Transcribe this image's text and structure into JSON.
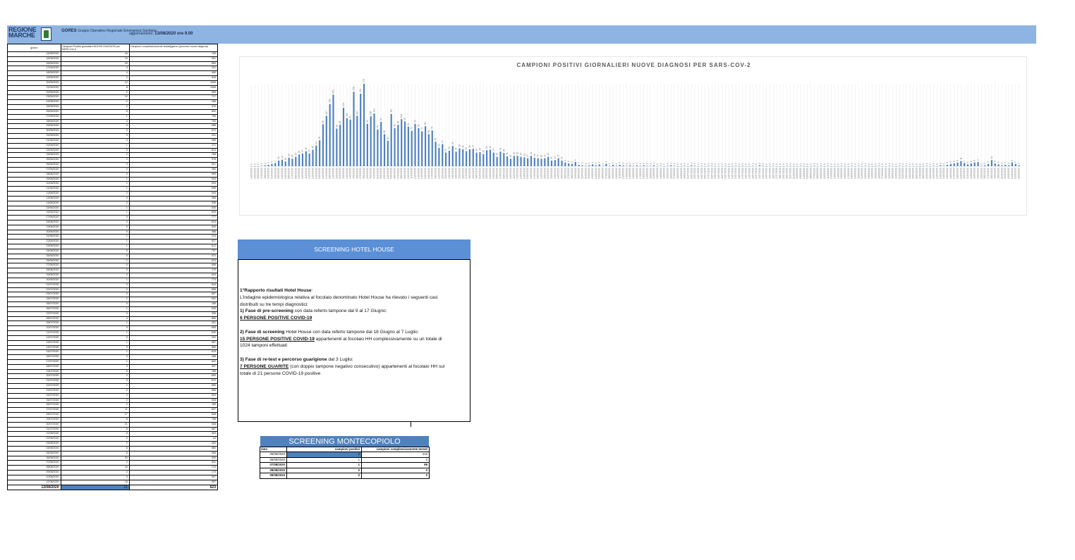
{
  "header": {
    "logo_text": "REGIONE MARCHE",
    "org_name": "GORES",
    "org_desc": "Gruppo Operativo Regionale Emergenza Sanitaria",
    "update_label": "aggiornamento:",
    "update_value": "13/08/2020 ore 9.00",
    "banner_color": "#8eb4e3"
  },
  "left_table": {
    "headers": [
      "giorno",
      "Campioni Positivi giornalieri NUOVE DIAGNOSI per SARS-Cov-2",
      "Campioni complessivamente testati(giorno (percorso nuove diagnosi)"
    ],
    "rows": [
      [
        "14/05/2020",
        "16",
        "783"
      ],
      [
        "15/05/2020",
        "24",
        "991"
      ],
      [
        "16/05/2020",
        "25",
        "863"
      ],
      [
        "17/05/2020",
        "4",
        "321"
      ],
      [
        "18/05/2020",
        "4",
        "460"
      ],
      [
        "19/05/2020",
        "2",
        "916"
      ],
      [
        "20/05/2020",
        "12",
        "1063"
      ],
      [
        "21/05/2020",
        "8",
        "1006"
      ],
      [
        "22/05/2020",
        "2",
        "559"
      ],
      [
        "23/05/2020",
        "12",
        "717"
      ],
      [
        "24/05/2020",
        "2",
        "398"
      ],
      [
        "25/05/2020",
        "2",
        "576"
      ],
      [
        "26/05/2020",
        "6",
        "892"
      ],
      [
        "27/05/2020",
        "1",
        "796"
      ],
      [
        "28/05/2020",
        "4",
        "750"
      ],
      [
        "29/05/2020",
        "4",
        "986"
      ],
      [
        "30/05/2020",
        "3",
        "670"
      ],
      [
        "31/05/2020",
        "0",
        "251"
      ],
      [
        "01/06/2020",
        "4",
        "386"
      ],
      [
        "02/06/2020",
        "1",
        "371"
      ],
      [
        "03/06/2020",
        "3",
        "624"
      ],
      [
        "04/06/2020",
        "2",
        "768"
      ],
      [
        "05/06/2020",
        "2",
        "978"
      ],
      [
        "06/06/2020",
        "3",
        "601"
      ],
      [
        "07/06/2020",
        "0",
        "360"
      ],
      [
        "08/06/2020",
        "0",
        "599"
      ],
      [
        "09/06/2020",
        "1",
        "903"
      ],
      [
        "10/06/2020",
        "1",
        "694"
      ],
      [
        "11/06/2020",
        "1",
        "698"
      ],
      [
        "12/06/2020",
        "2",
        "544"
      ],
      [
        "13/06/2020",
        "4",
        "385"
      ],
      [
        "14/06/2020",
        "2",
        "398"
      ],
      [
        "15/06/2020",
        "1",
        "630"
      ],
      [
        "16/06/2020",
        "1",
        "633"
      ],
      [
        "17/06/2020",
        "4",
        "777"
      ],
      [
        "18/06/2020",
        "0",
        "624"
      ],
      [
        "19/06/2020",
        "0",
        "549"
      ],
      [
        "20/06/2020",
        "0",
        "488"
      ],
      [
        "21/06/2020",
        "1",
        "224"
      ],
      [
        "22/06/2020",
        "1",
        "527"
      ],
      [
        "23/06/2020",
        "1",
        "612"
      ],
      [
        "24/06/2020",
        "0",
        "797"
      ],
      [
        "25/06/2020",
        "0",
        "572"
      ],
      [
        "26/06/2020",
        "2",
        "623"
      ],
      [
        "27/06/2020",
        "0",
        "656"
      ],
      [
        "28/06/2020",
        "0",
        "179"
      ],
      [
        "29/06/2020",
        "0",
        "624"
      ],
      [
        "30/06/2020",
        "1",
        "774"
      ],
      [
        "01/07/2020",
        "3",
        "844"
      ],
      [
        "02/07/2020",
        "0",
        "686"
      ],
      [
        "03/07/2020",
        "0",
        "857"
      ],
      [
        "04/07/2020",
        "1",
        "602"
      ],
      [
        "05/07/2020",
        "0",
        "185"
      ],
      [
        "06/07/2020",
        "1",
        "549"
      ],
      [
        "07/07/2020",
        "3",
        "396"
      ],
      [
        "08/07/2020",
        "4",
        "660"
      ],
      [
        "09/07/2020",
        "1",
        "451"
      ],
      [
        "10/07/2020",
        "0",
        "605"
      ],
      [
        "11/07/2020",
        "1",
        "630"
      ],
      [
        "12/07/2020",
        "0",
        "202"
      ],
      [
        "13/07/2020",
        "1",
        "557"
      ],
      [
        "14/07/2020",
        "0",
        "650"
      ],
      [
        "15/07/2020",
        "1",
        "619"
      ],
      [
        "16/07/2020",
        "3",
        "458"
      ],
      [
        "17/07/2020",
        "1",
        "542"
      ],
      [
        "18/07/2020",
        "0",
        "497"
      ],
      [
        "19/07/2020",
        "0",
        "185"
      ],
      [
        "20/07/2020",
        "2",
        "650"
      ],
      [
        "21/07/2020",
        "3",
        "672"
      ],
      [
        "22/07/2020",
        "1",
        "660"
      ],
      [
        "23/07/2020",
        "2",
        "558"
      ],
      [
        "24/07/2020",
        "2",
        "503"
      ],
      [
        "25/07/2020",
        "2",
        "528"
      ],
      [
        "26/07/2020",
        "2",
        "189"
      ],
      [
        "27/07/2020",
        "11",
        "607"
      ],
      [
        "28/07/2020",
        "17",
        "698"
      ],
      [
        "29/07/2020",
        "8",
        "756"
      ],
      [
        "30/07/2020",
        "21",
        "506"
      ],
      [
        "31/07/2020",
        "5",
        "567"
      ],
      [
        "01/08/2020",
        "8",
        "563"
      ],
      [
        "02/08/2020",
        "0",
        "54"
      ],
      [
        "03/08/2020",
        "2",
        "483"
      ],
      [
        "04/08/2020",
        "6",
        "860"
      ],
      [
        "05/08/2020",
        "6",
        "558"
      ],
      [
        "06/08/2020",
        "20",
        "593"
      ],
      [
        "07/08/2020",
        "2",
        "531"
      ],
      [
        "08/08/2020",
        "16",
        "713"
      ],
      [
        "09/08/2020",
        "2",
        "173"
      ],
      [
        "10/08/2020",
        "4",
        "597"
      ],
      [
        "11/08/2020",
        "16",
        "557"
      ]
    ],
    "total": [
      "12/08/2020",
      "11",
      "623"
    ],
    "highlight_color": "#4f81bd"
  },
  "chart_data": {
    "type": "bar",
    "title": "CAMPIONI POSITIVI GIORNALIERI NUOVE DIAGNOSI PER SARS-COV-2",
    "series_color": "#4f81bd",
    "values": [
      0,
      0,
      0,
      1,
      2,
      3,
      5,
      7,
      12,
      14,
      10,
      18,
      16,
      20,
      25,
      27,
      32,
      27,
      35,
      44,
      55,
      89,
      107,
      132,
      152,
      80,
      88,
      124,
      102,
      99,
      158,
      107,
      154,
      175,
      90,
      106,
      112,
      78,
      94,
      68,
      54,
      111,
      81,
      88,
      100,
      95,
      84,
      75,
      90,
      81,
      74,
      85,
      68,
      76,
      52,
      39,
      47,
      29,
      33,
      43,
      31,
      38,
      36,
      32,
      36,
      37,
      29,
      30,
      26,
      34,
      35,
      29,
      20,
      31,
      28,
      21,
      16,
      22,
      22,
      20,
      19,
      17,
      22,
      18,
      17,
      16,
      17,
      20,
      12,
      13,
      17,
      12,
      8,
      6,
      5,
      9,
      3,
      2,
      1,
      2,
      4,
      2,
      4,
      1,
      5,
      1,
      3,
      1,
      3,
      2,
      1,
      2,
      1,
      2,
      1,
      2,
      1,
      1,
      2,
      0,
      1,
      0,
      1,
      2,
      1,
      0,
      0,
      1,
      0,
      2,
      1,
      0,
      1,
      0,
      1,
      1,
      0,
      0,
      0,
      1,
      0,
      0,
      1,
      0,
      1,
      0,
      0,
      1,
      0,
      2,
      1,
      0,
      0,
      1,
      0,
      0,
      0,
      1,
      0,
      0,
      0,
      1,
      0,
      0,
      0,
      1,
      0,
      1,
      0,
      1,
      0,
      0,
      0,
      1,
      0,
      0,
      1,
      0,
      1,
      0,
      1,
      0,
      0,
      0,
      1,
      0,
      0,
      1,
      0,
      0,
      1,
      0,
      1,
      0,
      0,
      0,
      0,
      0,
      1,
      0,
      1,
      0,
      2,
      1,
      3,
      5,
      6,
      8,
      11,
      7,
      4,
      6,
      8,
      9,
      1,
      2,
      5,
      13,
      6,
      4,
      2,
      3,
      2,
      8,
      5,
      2
    ],
    "first_date": "24/02/2020",
    "last_date": "12/08/2020",
    "xlabel": "",
    "ylabel": ""
  },
  "hotel_house": {
    "title": "SCREENING HOTEL HOUSE",
    "lines": [
      {
        "b": "1°Rapporto  risultati Hotel House",
        "t": ":"
      },
      {
        "b": "",
        "t": "L'indagine epidemiologica relativa al focolaio denominato Hotel House ha rilevato i seguenti casi"
      },
      {
        "b": "",
        "t": "distribuiti su tre tempi diagnostici:"
      },
      {
        "b": "1) Fase di pre-screening",
        "t": " con data referto tampone dal 9 al 17 Giugno:"
      },
      {
        "u": "6 PERSONE POSITIVE COVID-19",
        "t": ""
      },
      {
        "gap": true
      },
      {
        "b": "2) Fase di screening",
        "t": " Hotel House con data referto tampone dal 18 Giugno al 7 Luglio:"
      },
      {
        "u": "15 PERSONE POSITIVE COVID-19",
        "t": " appartenenti al focolaio HH complessivamente su un totale di"
      },
      {
        "b": "",
        "t": "1024 tamponi effettuati"
      },
      {
        "gap": true
      },
      {
        "b": "3) Fase di re-test e percorso guarigione",
        "t": " dal 3 Luglio:"
      },
      {
        "u": "7 PERSONE GUARITE",
        "t": " (con doppio tampone negativo consecutivo) appartenenti al focolaio HH sul"
      },
      {
        "b": "",
        "t": "totale di 21 persone COVID-19 positive"
      }
    ]
  },
  "montecopiolo": {
    "title": "SCREENING MONTECOPIOLO",
    "headers": [
      "data",
      "campioni positivi",
      "campioni complessivamente testati"
    ],
    "rows": [
      [
        "05/08/2020",
        "3",
        "215"
      ],
      [
        "06/08/2020",
        "1",
        "2"
      ],
      [
        "07/08/2020",
        "1",
        "99"
      ],
      [
        "08/08/2020",
        "0",
        "0"
      ],
      [
        "09/08/2020",
        "0",
        "0"
      ]
    ]
  }
}
